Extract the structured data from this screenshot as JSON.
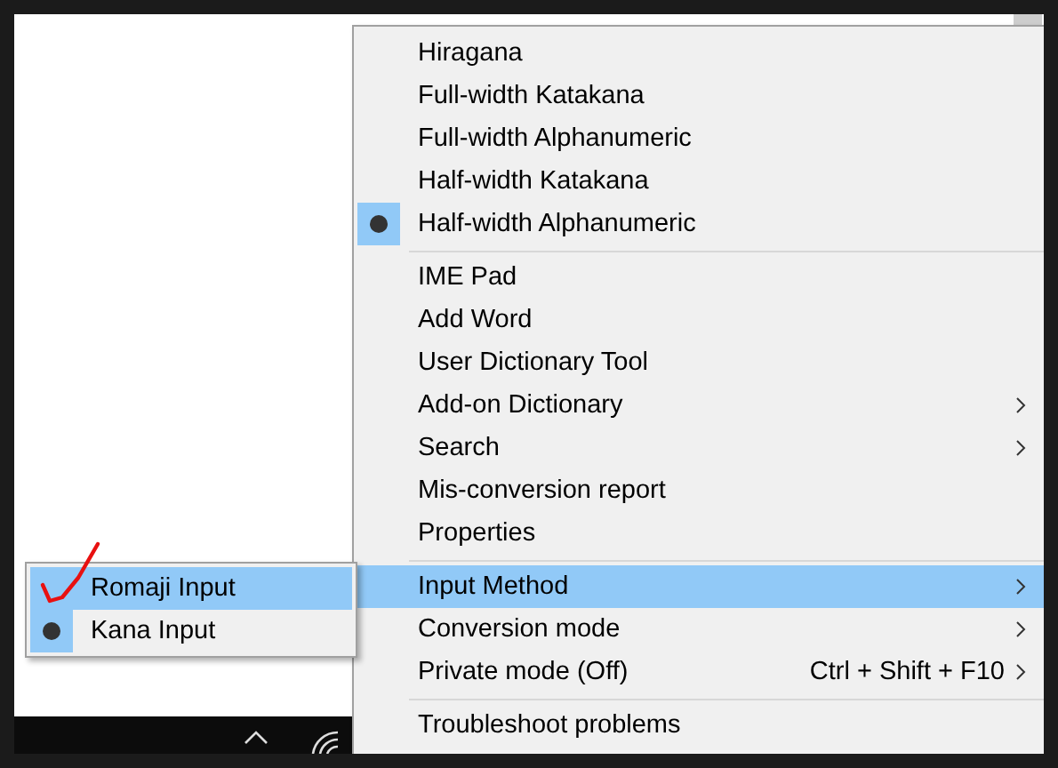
{
  "menu": {
    "groups": [
      [
        {
          "label": "Hiragana",
          "checked": false,
          "selected": false,
          "submenu": false
        },
        {
          "label": "Full-width Katakana",
          "checked": false,
          "selected": false,
          "submenu": false
        },
        {
          "label": "Full-width Alphanumeric",
          "checked": false,
          "selected": false,
          "submenu": false
        },
        {
          "label": "Half-width Katakana",
          "checked": false,
          "selected": false,
          "submenu": false
        },
        {
          "label": "Half-width Alphanumeric",
          "checked": true,
          "selected": false,
          "submenu": false
        }
      ],
      [
        {
          "label": "IME Pad",
          "checked": false,
          "selected": false,
          "submenu": false
        },
        {
          "label": "Add Word",
          "checked": false,
          "selected": false,
          "submenu": false
        },
        {
          "label": "User Dictionary Tool",
          "checked": false,
          "selected": false,
          "submenu": false
        },
        {
          "label": "Add-on Dictionary",
          "checked": false,
          "selected": false,
          "submenu": true
        },
        {
          "label": "Search",
          "checked": false,
          "selected": false,
          "submenu": true
        },
        {
          "label": "Mis-conversion report",
          "checked": false,
          "selected": false,
          "submenu": false
        },
        {
          "label": "Properties",
          "checked": false,
          "selected": false,
          "submenu": false
        }
      ],
      [
        {
          "label": "Input Method",
          "checked": false,
          "selected": true,
          "submenu": true
        },
        {
          "label": "Conversion mode",
          "checked": false,
          "selected": false,
          "submenu": true
        },
        {
          "label": "Private mode (Off)",
          "shortcut": "Ctrl + Shift + F10",
          "checked": false,
          "selected": false,
          "submenu": true
        }
      ],
      [
        {
          "label": "Troubleshoot problems",
          "checked": false,
          "selected": false,
          "submenu": false
        }
      ]
    ]
  },
  "submenu": {
    "items": [
      {
        "label": "Romaji Input",
        "checked": false,
        "selected": true
      },
      {
        "label": "Kana Input",
        "checked": true,
        "selected": false
      }
    ]
  }
}
